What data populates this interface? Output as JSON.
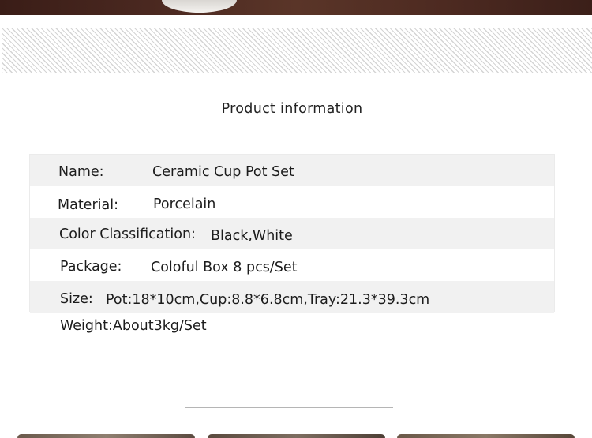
{
  "section_title": "Product information",
  "rows": [
    {
      "label": "Name:",
      "value": "Ceramic Cup Pot Set"
    },
    {
      "label": "Material:",
      "value": "Porcelain"
    },
    {
      "label": "Color Classification:",
      "value": "Black,White"
    },
    {
      "label": "Package:",
      "value": "Coloful Box 8 pcs/Set"
    },
    {
      "label": "Size:",
      "value": "Pot:18*10cm,Cup:8.8*6.8cm,Tray:21.3*39.3cm"
    }
  ],
  "weight_text": "Weight:About3kg/Set",
  "colors": {
    "row_shade": "#f1f1f1",
    "text": "#1c1c1c",
    "photo_dark": "#4a2820"
  }
}
